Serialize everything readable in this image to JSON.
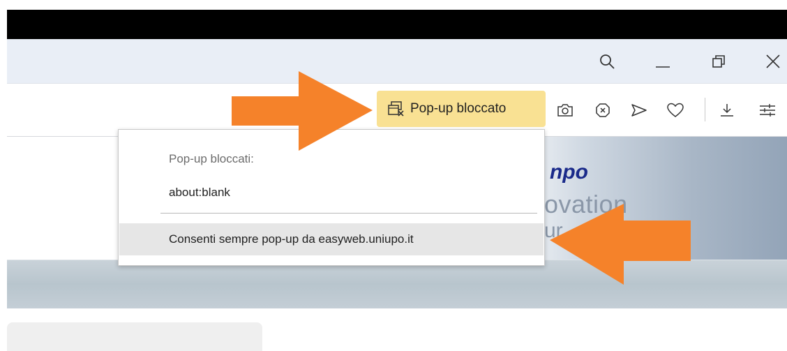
{
  "toolbar": {
    "popup_blocked_label": "Pop-up bloccato"
  },
  "popup_menu": {
    "title": "Pop-up bloccati:",
    "blocked_url": "about:blank",
    "allow_always": "Consenti sempre pop-up da easyweb.uniupo.it"
  },
  "page": {
    "logo_line1": "npo",
    "logo_line2": "ovation",
    "logo_line3": "ur"
  },
  "annotations": {
    "arrow_color": "#f5822a",
    "chip_color": "#f9e193"
  },
  "icons": {
    "titlebar": [
      "search-icon",
      "minimize-icon",
      "restore-icon",
      "close-icon"
    ],
    "toolbar": [
      "popup-blocked-icon",
      "camera-icon",
      "tracking-blocker-icon",
      "send-icon",
      "heart-icon",
      "download-icon",
      "easy-setup-icon"
    ]
  }
}
